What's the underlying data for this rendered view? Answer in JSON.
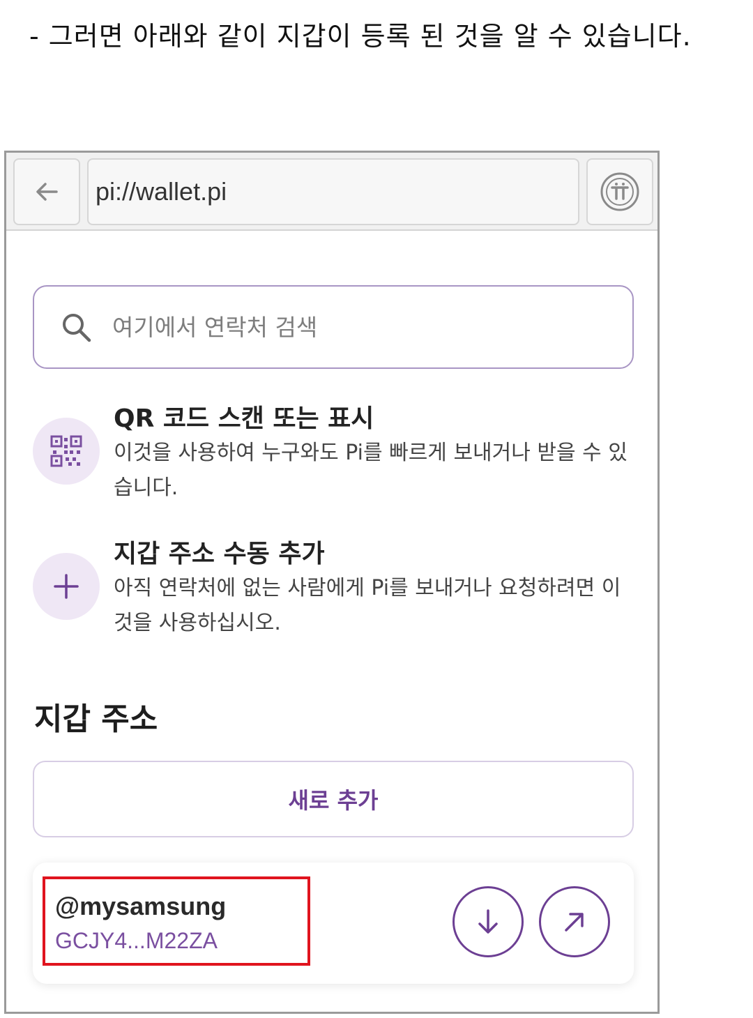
{
  "caption": {
    "text": "- 그러면 아래와 같이 지갑이 등록 된 것을 알 수 있습니다."
  },
  "browser": {
    "url": "pi://wallet.pi",
    "back_icon": "back-arrow-icon",
    "pi_icon": "pi-logo-icon"
  },
  "search": {
    "placeholder": "여기에서 연락처 검색",
    "icon": "search-icon"
  },
  "options": [
    {
      "title": "QR 코드 스캔 또는 표시",
      "description": "이것을 사용하여 누구와도 Pi를 빠르게 보내거나 받을 수 있습니다.",
      "icon": "qr-code-icon"
    },
    {
      "title": "지갑 주소 수동 추가",
      "description": "아직 연락처에 없는 사람에게 Pi를 보내거나 요청하려면 이것을 사용하십시오.",
      "icon": "plus-icon"
    }
  ],
  "wallet_section": {
    "title": "지갑 주소",
    "add_new_label": "새로 추가",
    "entries": [
      {
        "name": "@mysamsung",
        "address": "GCJY4...M22ZA",
        "receive_icon": "arrow-down-icon",
        "send_icon": "arrow-up-right-icon"
      }
    ]
  },
  "colors": {
    "accent": "#6c3f93",
    "highlight": "#e0141e",
    "icon_bg": "#efe7f5"
  }
}
